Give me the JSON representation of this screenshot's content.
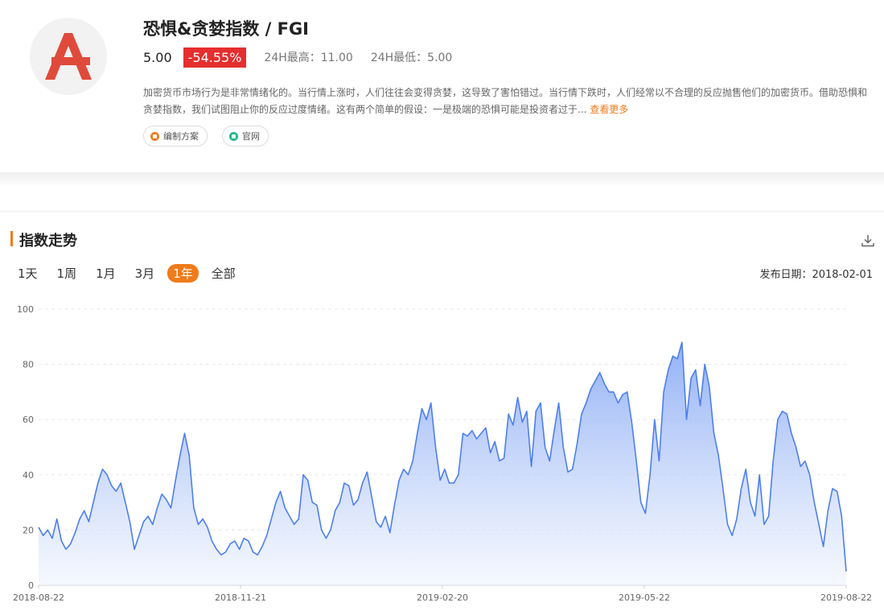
{
  "header": {
    "logo_alt": "A",
    "title": "恐惧&贪婪指数 / FGI",
    "price": "5.00",
    "change": "-54.55%",
    "high_label": "24H最高：11.00",
    "low_label": "24H最低：5.00",
    "description": "加密货币市场行为是非常情绪化的。当行情上涨时，人们往往会变得贪婪，这导致了害怕错过。当行情下跌时，人们经常以不合理的反应抛售他们的加密货币。借助恐惧和贪婪指数，我们试图阻止你的反应过度情绪。这有两个简单的假设：一是极端的恐惧可能是投资者过于...",
    "more_link": "查看更多",
    "tags": [
      {
        "label": "编制方案",
        "icon": "document-icon",
        "color": "#f07b1b"
      },
      {
        "label": "官网",
        "icon": "home-icon",
        "color": "#1fb88a"
      }
    ]
  },
  "section": {
    "title": "指数走势",
    "download_icon": "download-icon"
  },
  "ranges": [
    {
      "label": "1天",
      "active": false
    },
    {
      "label": "1周",
      "active": false
    },
    {
      "label": "1月",
      "active": false
    },
    {
      "label": "3月",
      "active": false
    },
    {
      "label": "1年",
      "active": true
    },
    {
      "label": "全部",
      "active": false
    }
  ],
  "release_date": "发布日期：2018-02-01",
  "colors": {
    "accent": "#f07b1b",
    "negative": "#e52e2e",
    "line": "#4d7ff0"
  },
  "chart_data": {
    "type": "area",
    "title": "",
    "xlabel": "",
    "ylabel": "",
    "ylim": [
      0,
      100
    ],
    "yticks": [
      0,
      20,
      40,
      60,
      80,
      100
    ],
    "xticks": [
      "2018-08-22",
      "2018-11-21",
      "2019-02-20",
      "2019-05-22",
      "2019-08-22"
    ],
    "grid": true,
    "series": [
      {
        "x_start": "2018-08-22",
        "x_step_days": 3,
        "values": [
          21,
          18,
          20,
          17,
          24,
          16,
          13,
          15,
          19,
          24,
          27,
          23,
          30,
          37,
          42,
          40,
          36,
          34,
          37,
          30,
          23,
          13,
          18,
          23,
          25,
          22,
          28,
          33,
          31,
          28,
          38,
          47,
          55,
          47,
          28,
          22,
          24,
          21,
          16,
          13,
          11,
          12,
          15,
          16,
          13,
          17,
          16,
          12,
          11,
          14,
          18,
          24,
          30,
          34,
          28,
          25,
          22,
          24,
          40,
          38,
          30,
          29,
          20,
          17,
          20,
          27,
          30,
          37,
          36,
          29,
          31,
          37,
          41,
          32,
          23,
          21,
          25,
          19,
          29,
          38,
          42,
          40,
          45,
          55,
          64,
          60,
          66,
          50,
          38,
          42,
          37,
          37,
          40,
          55,
          54,
          56,
          53,
          55,
          57,
          48,
          52,
          45,
          46,
          62,
          58,
          68,
          59,
          63,
          43,
          63,
          66,
          50,
          45,
          56,
          66,
          50,
          41,
          42,
          51,
          62,
          66,
          71,
          74,
          77,
          73,
          70,
          70,
          66,
          69,
          70,
          59,
          45,
          30,
          26,
          40,
          60,
          45,
          70,
          78,
          83,
          82,
          88,
          60,
          75,
          78,
          65,
          80,
          72,
          55,
          47,
          35,
          22,
          18,
          24,
          35,
          42,
          30,
          25,
          40,
          22,
          25,
          45,
          60,
          63,
          62,
          55,
          50,
          43,
          45,
          40,
          30,
          22,
          14,
          27,
          35,
          34,
          25,
          5
        ]
      }
    ]
  }
}
